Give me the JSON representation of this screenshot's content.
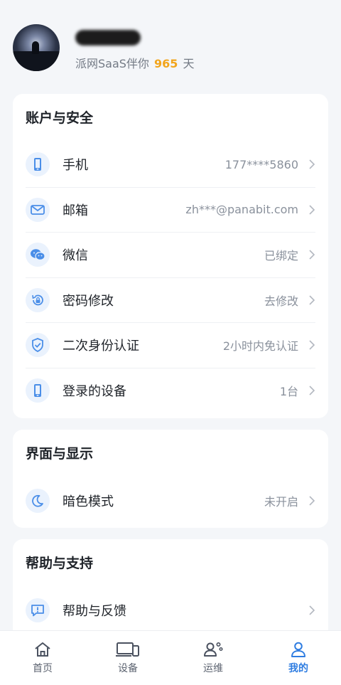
{
  "profile": {
    "tagline_prefix": "派网SaaS伴你",
    "days": "965",
    "tagline_suffix": "天"
  },
  "sections": [
    {
      "title": "账户与安全",
      "items": [
        {
          "icon": "phone-icon",
          "label": "手机",
          "value": "177****5860"
        },
        {
          "icon": "mail-icon",
          "label": "邮箱",
          "value": "zh***@panabit.com"
        },
        {
          "icon": "wechat-icon",
          "label": "微信",
          "value": "已绑定"
        },
        {
          "icon": "password-reset-icon",
          "label": "密码修改",
          "value": "去修改"
        },
        {
          "icon": "shield-check-icon",
          "label": "二次身份认证",
          "value": "2小时内免认证"
        },
        {
          "icon": "device-icon",
          "label": "登录的设备",
          "value": "1台"
        }
      ]
    },
    {
      "title": "界面与显示",
      "items": [
        {
          "icon": "moon-icon",
          "label": "暗色模式",
          "value": "未开启"
        }
      ]
    },
    {
      "title": "帮助与支持",
      "items": [
        {
          "icon": "feedback-icon",
          "label": "帮助与反馈",
          "value": ""
        }
      ]
    }
  ],
  "tabbar": [
    {
      "icon": "home-icon",
      "label": "首页",
      "active": false
    },
    {
      "icon": "devices-icon",
      "label": "设备",
      "active": false
    },
    {
      "icon": "operations-icon",
      "label": "运维",
      "active": false
    },
    {
      "icon": "user-icon",
      "label": "我的",
      "active": true
    }
  ],
  "colors": {
    "accent": "#2f7de1",
    "highlight": "#f2a51c",
    "icon_bg": "#eaf2fd"
  }
}
